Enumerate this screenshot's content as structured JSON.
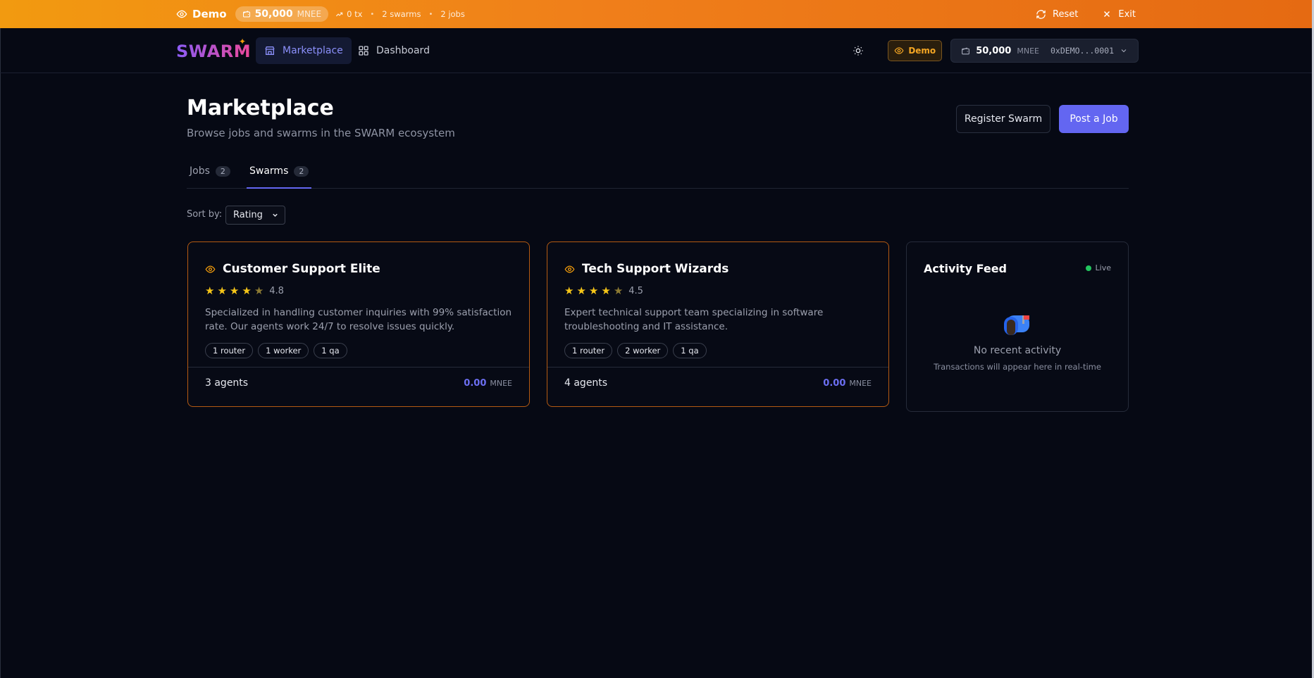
{
  "demo_bar": {
    "label": "Demo",
    "balance": "50,000",
    "unit": "MNEE",
    "tx": "0 tx",
    "swarms": "2 swarms",
    "jobs": "2 jobs",
    "reset": "Reset",
    "exit": "Exit"
  },
  "nav": {
    "logo": "SWARM",
    "marketplace": "Marketplace",
    "dashboard": "Dashboard",
    "demo_badge": "Demo",
    "wallet_balance": "50,000",
    "wallet_unit": "MNEE",
    "wallet_address": "0xDEMO...0001"
  },
  "header": {
    "title": "Marketplace",
    "subtitle": "Browse jobs and swarms in the SWARM ecosystem",
    "register_button": "Register Swarm",
    "post_button": "Post a Job"
  },
  "tabs": [
    {
      "label": "Jobs",
      "count": "2"
    },
    {
      "label": "Swarms",
      "count": "2"
    }
  ],
  "sort": {
    "label": "Sort by:",
    "value": "Rating"
  },
  "swarms": [
    {
      "name": "Customer Support Elite",
      "rating": "4.8",
      "stars_full": 4,
      "description": "Specialized in handling customer inquiries with 99% satisfaction rate. Our agents work 24/7 to resolve issues quickly.",
      "tags": [
        "1 router",
        "1 worker",
        "1 qa"
      ],
      "agents": "3 agents",
      "price": "0.00",
      "unit": "MNEE"
    },
    {
      "name": "Tech Support Wizards",
      "rating": "4.5",
      "stars_full": 4,
      "description": "Expert technical support team specializing in software troubleshooting and IT assistance.",
      "tags": [
        "1 router",
        "2 worker",
        "1 qa"
      ],
      "agents": "4 agents",
      "price": "0.00",
      "unit": "MNEE"
    }
  ],
  "feed": {
    "title": "Activity Feed",
    "live": "Live",
    "icon": "📭",
    "empty_title": "No recent activity",
    "empty_sub": "Transactions will appear here in real-time"
  },
  "colors": {
    "accent": "#6366f1",
    "banner": "#f07f1a",
    "card_border": "#b45a12",
    "star": "#f5c518",
    "live": "#22c55e"
  }
}
